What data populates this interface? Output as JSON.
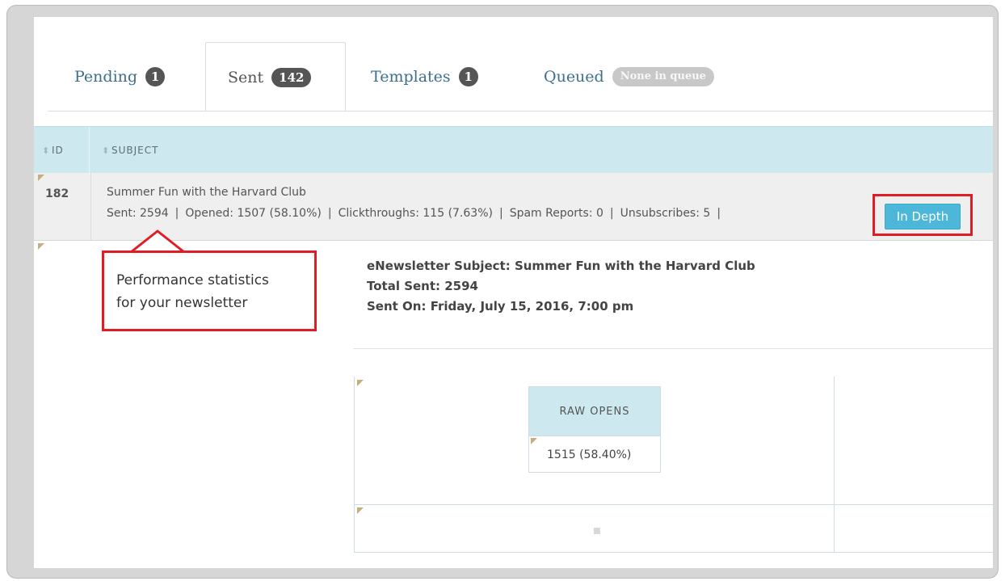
{
  "tabs": [
    {
      "label": "Pending",
      "badge": "1"
    },
    {
      "label": "Sent",
      "badge": "142"
    },
    {
      "label": "Templates",
      "badge": "1"
    },
    {
      "label": "Queued",
      "badge": "None in queue"
    }
  ],
  "table": {
    "columns": [
      "ID",
      "SUBJECT"
    ],
    "row": {
      "id": "182",
      "subject": "Summer Fun with the Harvard Club",
      "stats": [
        "Sent: 2594",
        "Opened: 1507 (58.10%)",
        "Clickthroughs: 115 (7.63%)",
        "Spam Reports: 0",
        "Unsubscribes: 5"
      ],
      "separator": "|",
      "action_label": "In Depth"
    }
  },
  "details": {
    "subject_line": "eNewsletter Subject: Summer Fun with the Harvard Club",
    "total_sent": "Total Sent: 2594",
    "sent_on": "Sent On: Friday, July 15, 2016, 7:00 pm"
  },
  "raw_opens": {
    "header": "RAW OPENS",
    "value": "1515 (58.40%)"
  },
  "annotation": {
    "line1": "Performance statistics",
    "line2": "for your newsletter",
    "color": "#e01d24"
  },
  "colors": {
    "header_bg": "#cde9ef",
    "button": "#4cb7d9",
    "tab_link": "#3d6f8d"
  }
}
